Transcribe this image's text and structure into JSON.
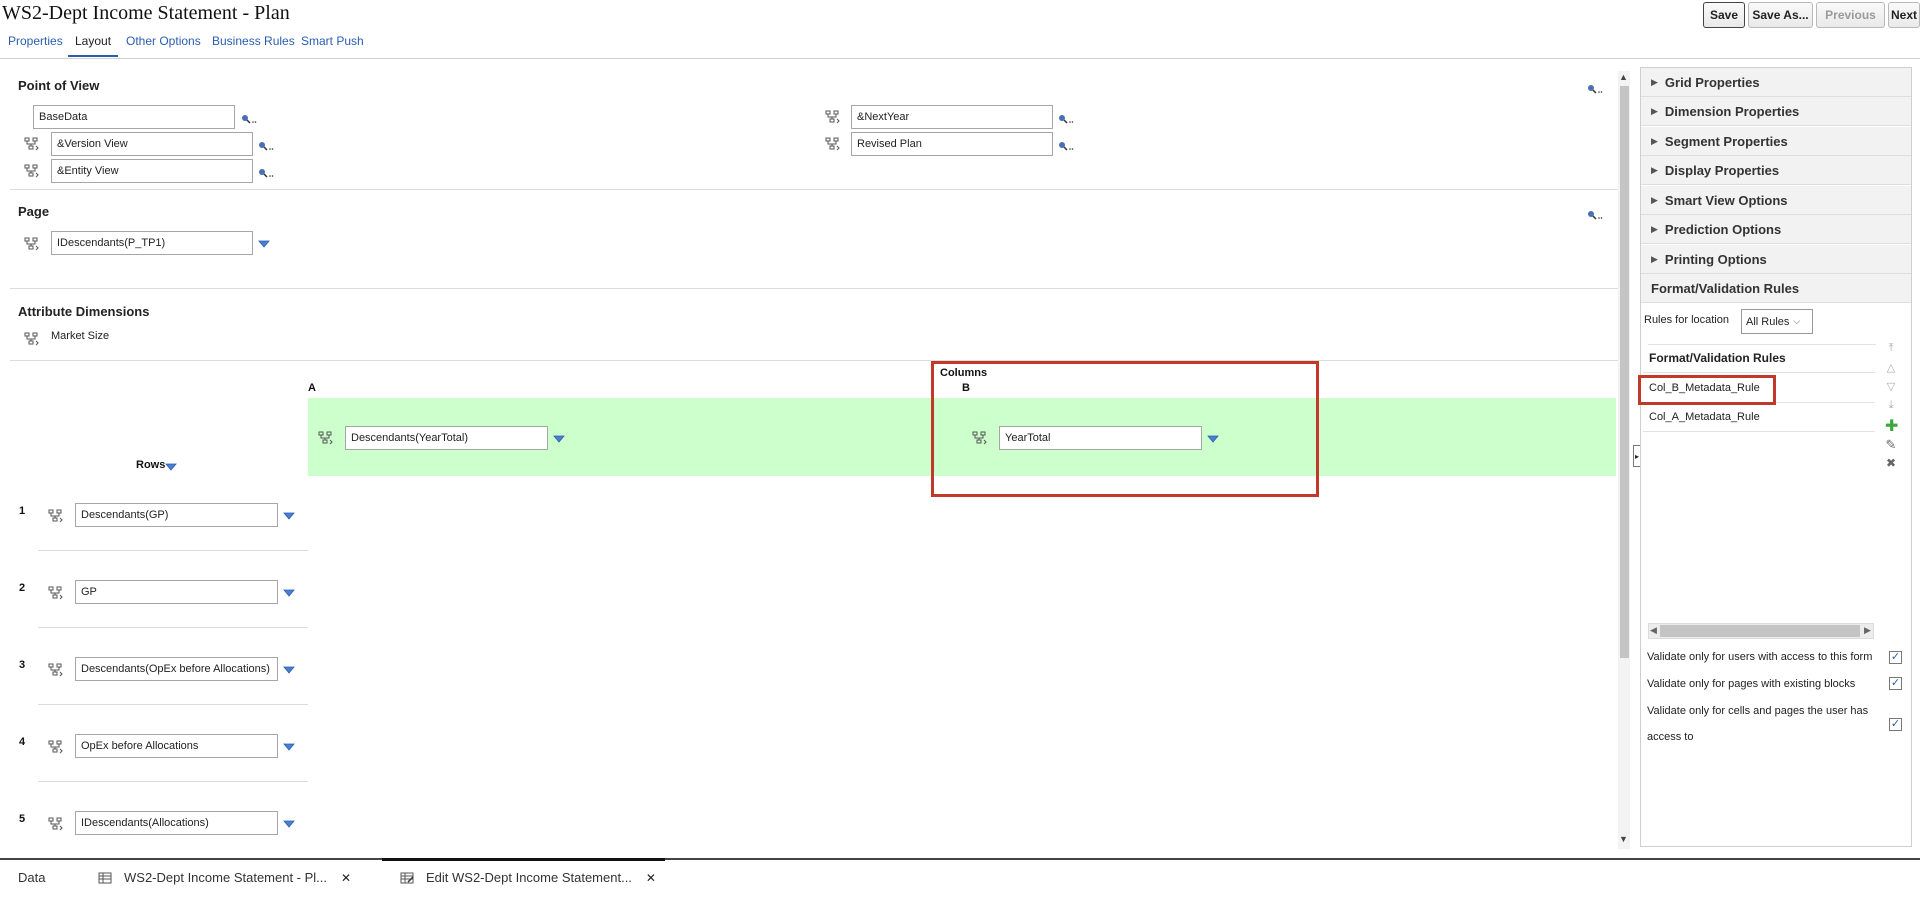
{
  "header": {
    "title": "WS2-Dept Income Statement - Plan",
    "tabs": [
      "Properties",
      "Layout",
      "Other Options",
      "Business Rules",
      "Smart Push"
    ],
    "buttons": {
      "save": "Save",
      "save_as": "Save As...",
      "previous": "Previous",
      "next": "Next"
    }
  },
  "pov": {
    "title": "Point of View",
    "fields": [
      "BaseData",
      "&Version View",
      "&Entity View",
      "&NextYear",
      "Revised Plan"
    ]
  },
  "page": {
    "title": "Page",
    "field": "IDescendants(P_TP1)"
  },
  "attributes": {
    "title": "Attribute Dimensions",
    "item": "Market Size"
  },
  "columns": {
    "label": "Columns",
    "col_a": "A",
    "col_b": "B",
    "a_value": "Descendants(YearTotal)",
    "b_value": "YearTotal"
  },
  "rows": {
    "label": "Rows",
    "items": [
      {
        "num": "1",
        "value": "Descendants(GP)"
      },
      {
        "num": "2",
        "value": "GP"
      },
      {
        "num": "3",
        "value": "Descendants(OpEx before Allocations)"
      },
      {
        "num": "4",
        "value": "OpEx before Allocations"
      },
      {
        "num": "5",
        "value": "IDescendants(Allocations)"
      }
    ]
  },
  "panel": {
    "accordion": [
      "Grid Properties",
      "Dimension Properties",
      "Segment Properties",
      "Display Properties",
      "Smart View Options",
      "Prediction Options",
      "Printing Options"
    ],
    "format_title": "Format/Validation Rules",
    "rules_for_location_label": "Rules for location",
    "rules_select": "All Rules",
    "list_header": "Format/Validation Rules",
    "rules": [
      "Col_B_Metadata_Rule",
      "Col_A_Metadata_Rule"
    ],
    "checks": [
      {
        "label": "Validate only for users with access to this form",
        "checked": true
      },
      {
        "label": "Validate only for pages with existing blocks",
        "checked": true
      },
      {
        "label": "Validate only for cells and pages the user has access to",
        "checked": true
      }
    ]
  },
  "bottom_tabs": {
    "data": "Data",
    "tab1": "WS2-Dept Income Statement - Pl...",
    "tab2": "Edit WS2-Dept Income Statement..."
  },
  "colors": {
    "accent": "#2a5db0",
    "highlight": "#c0392b",
    "column_band": "#ccffcc"
  }
}
